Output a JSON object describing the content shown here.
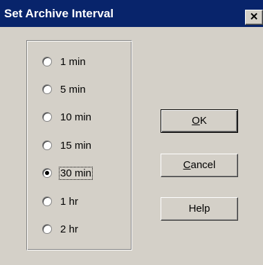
{
  "window": {
    "title": "Set Archive Interval",
    "close_symbol": "✕",
    "background_color": "#d4d0c8",
    "title_bar_color": "#08246b"
  },
  "interval_options": [
    {
      "label": "1 min",
      "checked": false
    },
    {
      "label": "5 min",
      "checked": false
    },
    {
      "label": "10 min",
      "checked": false
    },
    {
      "label": "15 min",
      "checked": false
    },
    {
      "label": "30 min",
      "checked": true
    },
    {
      "label": "1 hr",
      "checked": false
    },
    {
      "label": "2 hr",
      "checked": false
    }
  ],
  "buttons": {
    "ok": {
      "mnemonic": "O",
      "rest": "K"
    },
    "cancel": {
      "mnemonic": "C",
      "rest": "ancel"
    },
    "help": {
      "label": "Help"
    }
  }
}
